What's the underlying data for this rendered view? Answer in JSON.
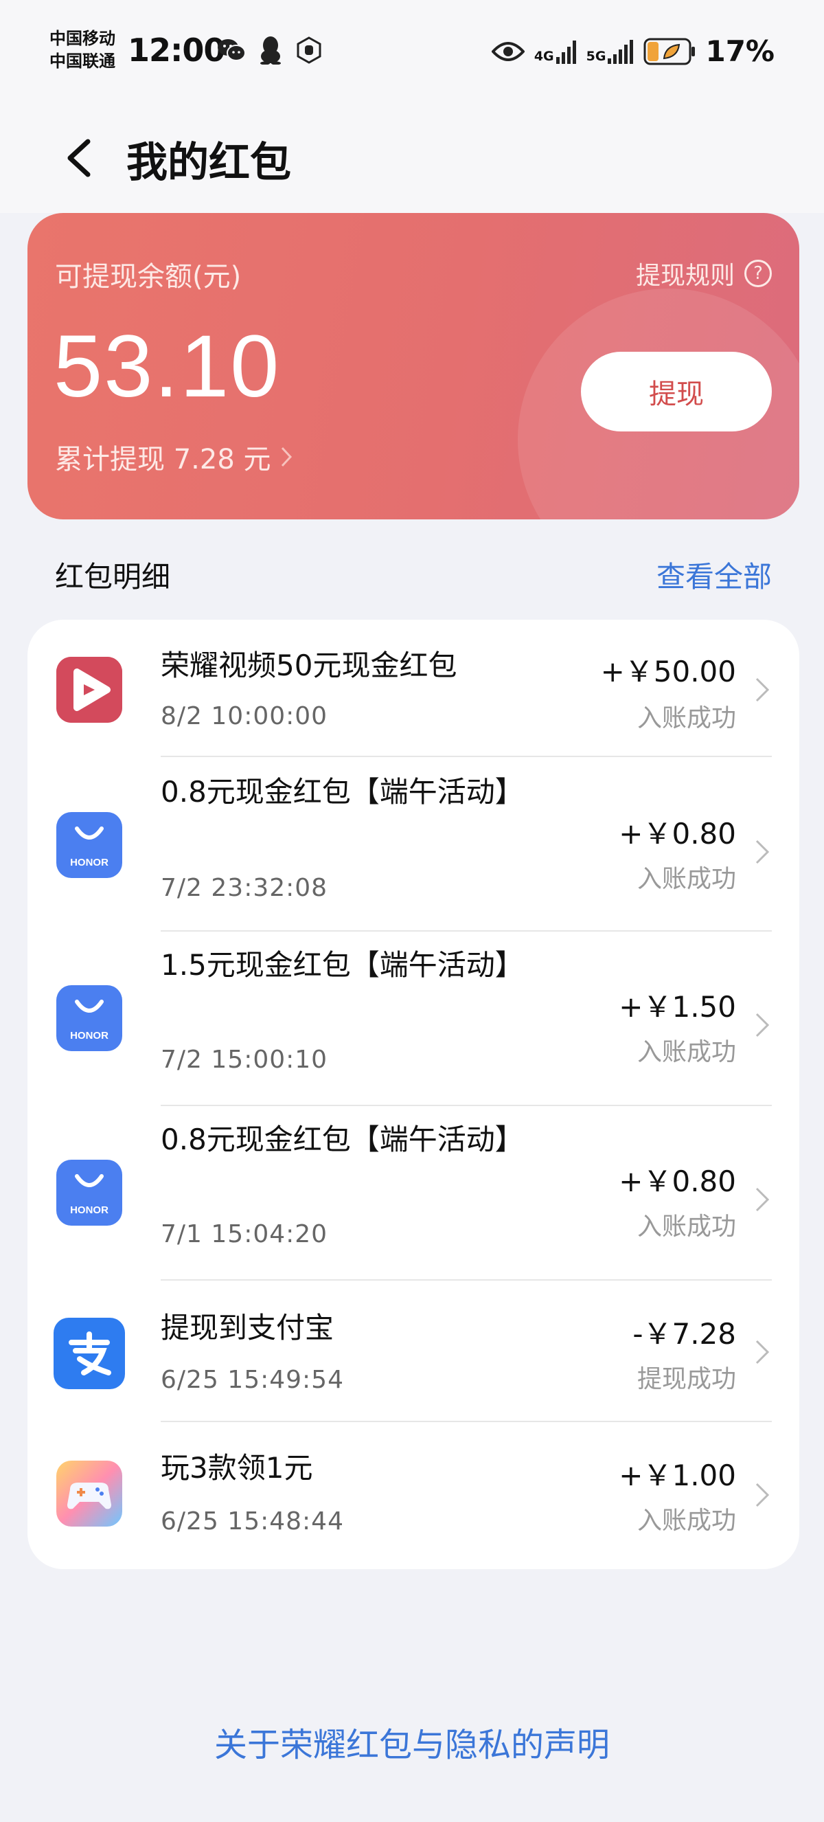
{
  "status_bar": {
    "carrier_1": "中国移动",
    "carrier_2": "中国联通",
    "time": "12:00",
    "net_1": "4G",
    "net_2": "5G",
    "battery": "17%"
  },
  "nav": {
    "title": "我的红包"
  },
  "balance": {
    "label": "可提现余额(元)",
    "amount": "53.10",
    "rules_label": "提现规则",
    "total_withdrawn": "累计提现 7.28 元",
    "withdraw_button": "提现"
  },
  "section": {
    "title": "红包明细",
    "view_all": "查看全部"
  },
  "records": [
    {
      "icon": "honor-video-icon",
      "title": "荣耀视频50元现金红包",
      "time": "8/2 10:00:00",
      "amount": "+￥50.00",
      "status": "入账成功"
    },
    {
      "icon": "honor-store-icon",
      "title": "0.8元现金红包【端午活动】",
      "time": "7/2 23:32:08",
      "amount": "+￥0.80",
      "status": "入账成功"
    },
    {
      "icon": "honor-store-icon",
      "title": "1.5元现金红包【端午活动】",
      "time": "7/2 15:00:10",
      "amount": "+￥1.50",
      "status": "入账成功"
    },
    {
      "icon": "honor-store-icon",
      "title": "0.8元现金红包【端午活动】",
      "time": "7/1 15:04:20",
      "amount": "+￥0.80",
      "status": "入账成功"
    },
    {
      "icon": "alipay-icon",
      "title": "提现到支付宝",
      "time": "6/25 15:49:54",
      "amount": "-￥7.28",
      "status": "提现成功"
    },
    {
      "icon": "game-center-icon",
      "title": "玩3款领1元",
      "time": "6/25 15:48:44",
      "amount": "+￥1.00",
      "status": "入账成功"
    }
  ],
  "honor_logo_text": "HONOR",
  "footer": {
    "privacy_link": "关于荣耀红包与隐私的声明"
  },
  "colors": {
    "accent_blue": "#3b76d8",
    "card_red": "#e46f6f",
    "withdraw_text": "#d24c4c"
  }
}
